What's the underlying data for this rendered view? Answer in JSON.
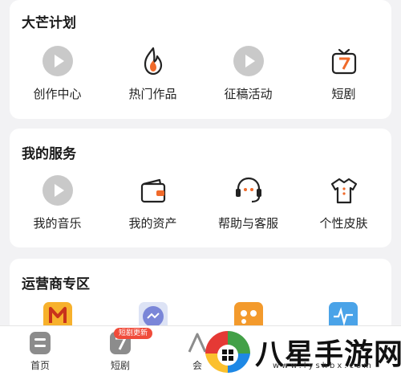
{
  "section1": {
    "title": "大芒计划",
    "items": [
      {
        "label": "创作中心",
        "icon": "play-circle-icon"
      },
      {
        "label": "热门作品",
        "icon": "flame-icon"
      },
      {
        "label": "征稿活动",
        "icon": "play-circle-icon"
      },
      {
        "label": "短剧",
        "icon": "tv-seven-icon"
      }
    ]
  },
  "section2": {
    "title": "我的服务",
    "items": [
      {
        "label": "我的音乐",
        "icon": "play-circle-icon"
      },
      {
        "label": "我的资产",
        "icon": "wallet-icon"
      },
      {
        "label": "帮助与客服",
        "icon": "headset-icon"
      },
      {
        "label": "个性皮肤",
        "icon": "tshirt-icon"
      }
    ]
  },
  "section3": {
    "title": "运营商专区",
    "apps": [
      "m-app-icon",
      "chat-app-icon",
      "orange-app-icon",
      "blue-app-icon"
    ]
  },
  "tabbar": {
    "tabs": [
      {
        "label": "首页",
        "icon": "home-icon"
      },
      {
        "label": "短剧",
        "icon": "shorts-icon"
      },
      {
        "label": "会",
        "icon": "member-icon"
      }
    ],
    "badge": "短剧更新"
  },
  "watermark": {
    "text": "八星手游网",
    "url": "www.lyshbx.com"
  },
  "colors": {
    "accent": "#f06a2a",
    "icon_gray": "#bfbfbf",
    "badge": "#f04b3a"
  }
}
